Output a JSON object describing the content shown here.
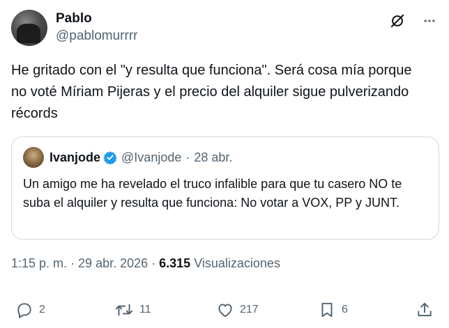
{
  "author": {
    "display_name": "Pablo",
    "handle": "@pablomurrrr"
  },
  "tweet": {
    "text": "He gritado con el \"y resulta que funciona\". Será cosa mía porque no voté Míriam Pijeras y el precio del alquiler sigue pulverizando récords"
  },
  "quote": {
    "display_name": "Ivanjode",
    "handle": "@Ivanjode",
    "separator": "·",
    "date": "28 abr.",
    "text": "Un amigo me ha revelado el truco infalible para que tu casero NO te suba el alquiler y resulta que funciona: No votar a VOX, PP y JUNT.",
    "verified": true
  },
  "meta": {
    "time": "1:15 p. m.",
    "separator": "·",
    "date": "29 abr. 2026",
    "views_count": "6.315",
    "views_label": "Visualizaciones"
  },
  "actions": {
    "replies": "2",
    "retweets": "11",
    "likes": "217",
    "bookmarks": "6"
  },
  "icons": {
    "header": [
      "grok-icon",
      "more-icon"
    ],
    "actions": [
      "reply-icon",
      "retweet-icon",
      "like-icon",
      "bookmark-icon",
      "share-icon"
    ],
    "verified": "verified-badge-icon"
  },
  "colors": {
    "text": "#0f1419",
    "secondary": "#536471",
    "border": "#cfd9de",
    "verified": "#1d9bf0"
  }
}
